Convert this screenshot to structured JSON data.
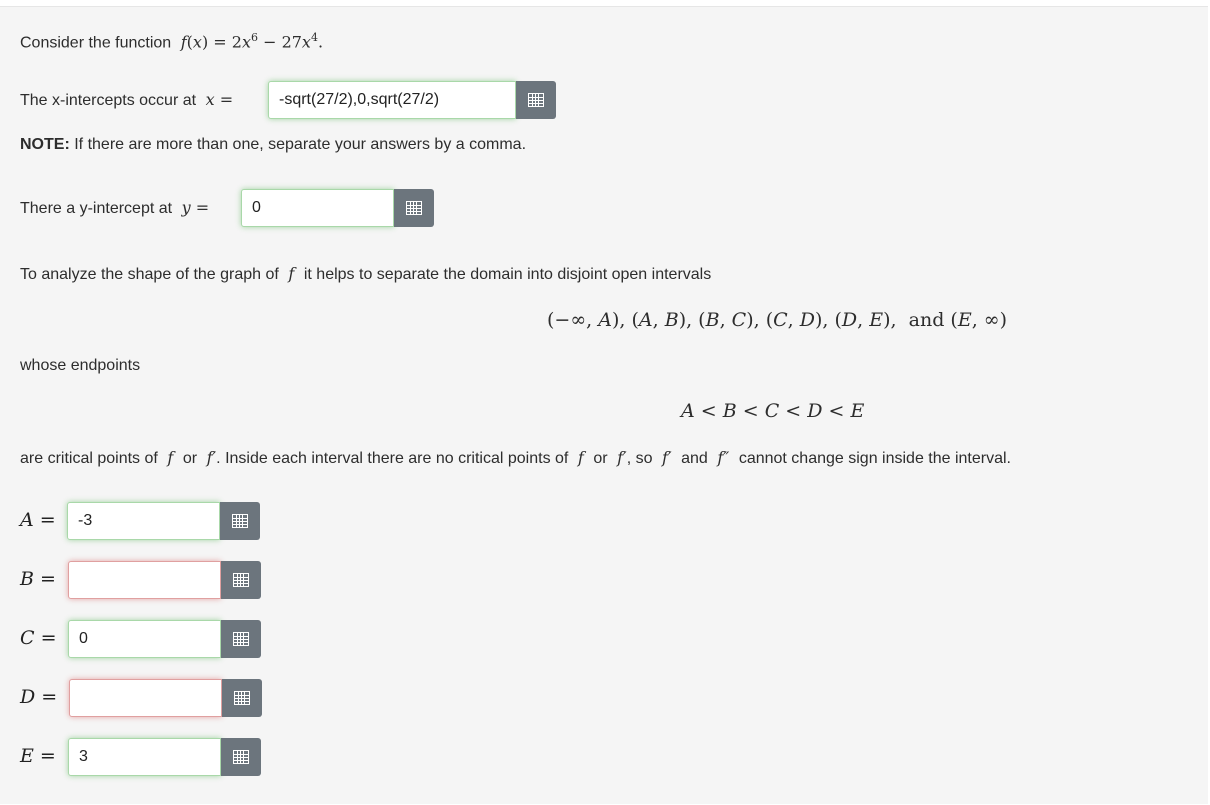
{
  "intro": {
    "text": "Consider the function"
  },
  "x_intercepts": {
    "prefix": "The x-intercepts occur at",
    "value": "-sqrt(27/2),0,sqrt(27/2)"
  },
  "note": {
    "bold": "NOTE:",
    "text": "If there are more than one, separate your answers by a comma."
  },
  "y_intercept": {
    "prefix": "There a y-intercept at",
    "value": "0"
  },
  "analyze": {
    "text_a": "To analyze the shape of the graph of",
    "text_b": "it helps to separate the domain into disjoint open intervals"
  },
  "whose": {
    "text": "whose endpoints"
  },
  "critical": {
    "t1": "are critical points of",
    "t2": "or",
    "t3": ". Inside each interval there are no critical points of",
    "t4": "or",
    "t5": ", so",
    "t6": "and",
    "t7": "cannot change sign inside the interval."
  },
  "answers": [
    {
      "label": "A",
      "value": "-3",
      "status": "correct"
    },
    {
      "label": "B",
      "value": "",
      "status": "incorrect"
    },
    {
      "label": "C",
      "value": "0",
      "status": "correct"
    },
    {
      "label": "D",
      "value": "",
      "status": "incorrect"
    },
    {
      "label": "E",
      "value": "3",
      "status": "correct"
    }
  ],
  "colors": {
    "correct": "#5cb85c",
    "incorrect": "#d9534f",
    "button": "#6c757d"
  },
  "icons": {
    "button_icon": "equation-editor-grid-icon"
  }
}
